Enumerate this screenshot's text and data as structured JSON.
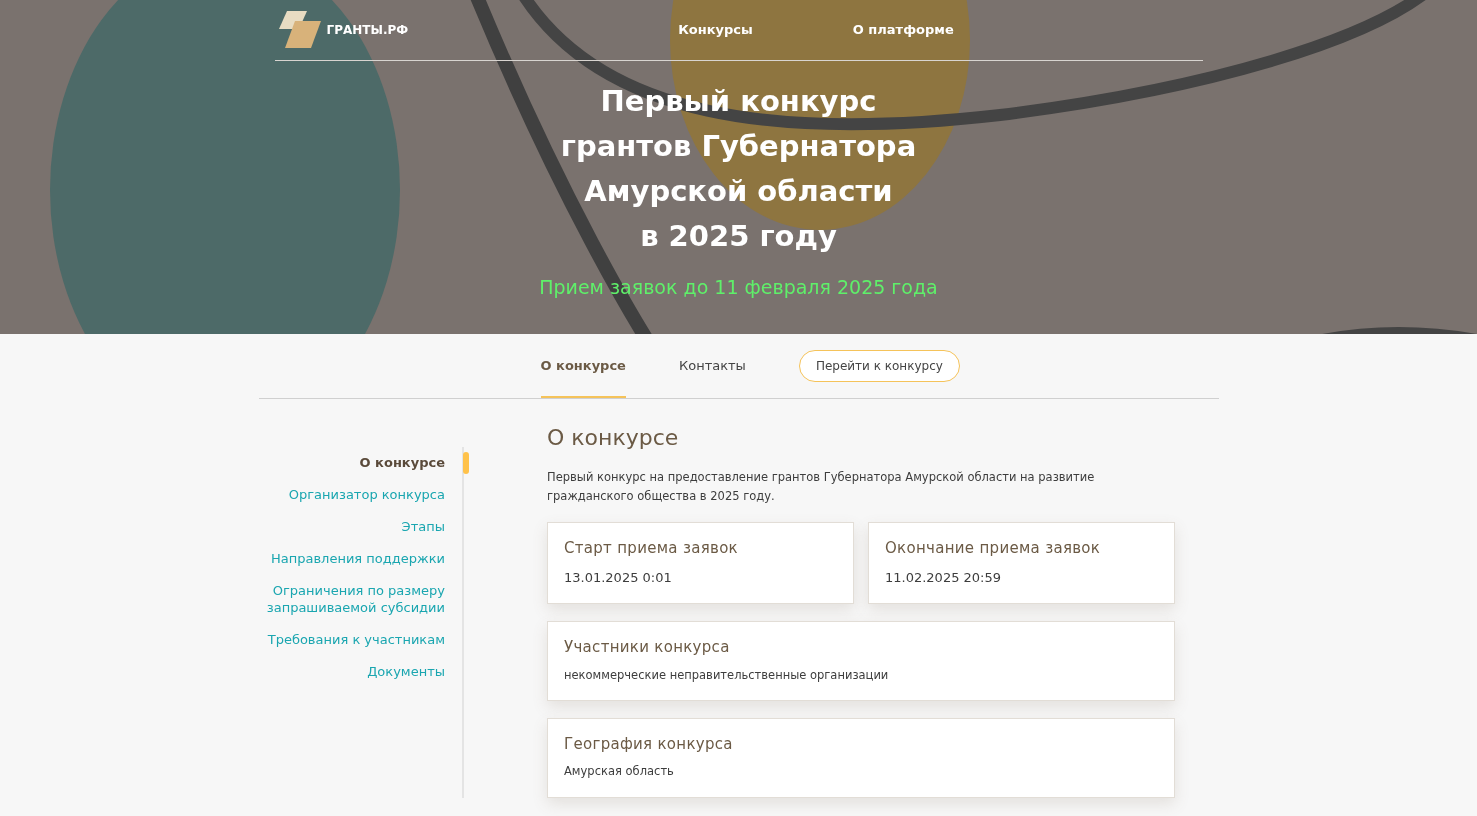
{
  "header": {
    "logo_text": "ГРАНТЫ.РФ",
    "nav": [
      "Конкурсы",
      "О платформе"
    ]
  },
  "hero": {
    "title_lines": [
      "Первый конкурс",
      "грантов Губернатора",
      "Амурской области",
      "в 2025 году"
    ],
    "deadline": "Прием заявок до 11 февраля 2025 года"
  },
  "tabs": [
    {
      "label": "О конкурсе",
      "selected": true
    },
    {
      "label": "Контакты",
      "selected": false
    }
  ],
  "cta_button": "Перейти к конкурсу",
  "sidebar": {
    "items": [
      {
        "label": "О конкурсе",
        "selected": true
      },
      {
        "label": "Организатор конкурса",
        "selected": false
      },
      {
        "label": "Этапы",
        "selected": false
      },
      {
        "label": "Направления поддержки",
        "selected": false
      },
      {
        "label": "Ограничения по размеру запрашиваемой субсидии",
        "selected": false
      },
      {
        "label": "Требования к участникам",
        "selected": false
      },
      {
        "label": "Документы",
        "selected": false
      }
    ]
  },
  "section": {
    "heading": "О конкурсе",
    "description": "Первый конкурс на предоставление грантов Губернатора Амурской области на развитие гражданского общества в 2025 году.",
    "cards": [
      {
        "kind": "date",
        "title": "Старт приема заявок",
        "value": "13.01.2025 0:01"
      },
      {
        "kind": "date",
        "title": "Окончание приема заявок",
        "value": "11.02.2025 20:59"
      },
      {
        "kind": "info",
        "title": "Участники конкурса",
        "value": "некоммерческие неправительственные организации"
      },
      {
        "kind": "info",
        "title": "География конкурса",
        "value": "Амурская область"
      }
    ]
  }
}
